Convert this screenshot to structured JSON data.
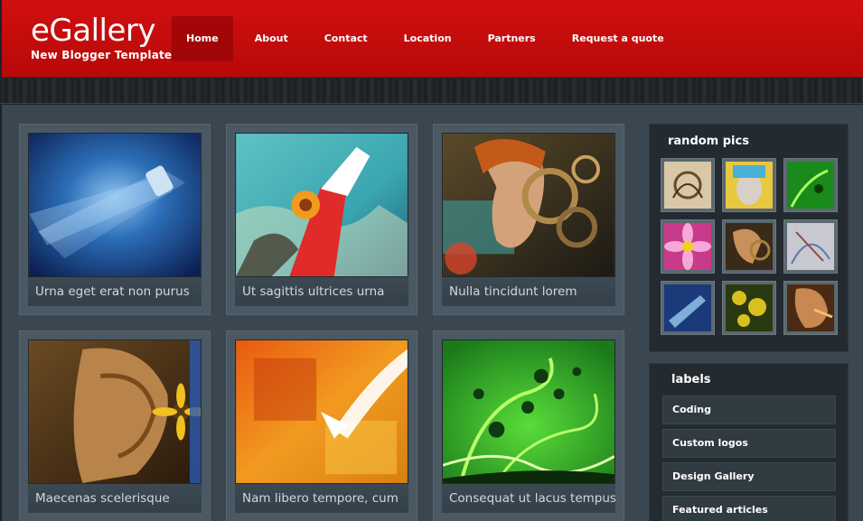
{
  "header": {
    "title": "eGallery",
    "subtitle": "New Blogger Template"
  },
  "nav": [
    {
      "label": "Home",
      "active": true
    },
    {
      "label": "About"
    },
    {
      "label": "Contact"
    },
    {
      "label": "Location"
    },
    {
      "label": "Partners"
    },
    {
      "label": "Request a quote"
    }
  ],
  "gallery": [
    {
      "caption": "Urna eget erat non purus"
    },
    {
      "caption": "Ut sagittis ultrices urna"
    },
    {
      "caption": "Nulla tincidunt lorem"
    },
    {
      "caption": "Maecenas scelerisque"
    },
    {
      "caption": "Nam libero tempore, cum"
    },
    {
      "caption": "Consequat ut lacus tempus"
    }
  ],
  "sidebar": {
    "random_pics_title": "random pics",
    "labels_title": "labels",
    "labels": [
      "Coding",
      "Custom logos",
      "Design Gallery",
      "Featured articles"
    ]
  },
  "colors": {
    "header_red": "#c70c0d",
    "content_bg": "#3a4750",
    "card_bg": "#4a5963"
  }
}
